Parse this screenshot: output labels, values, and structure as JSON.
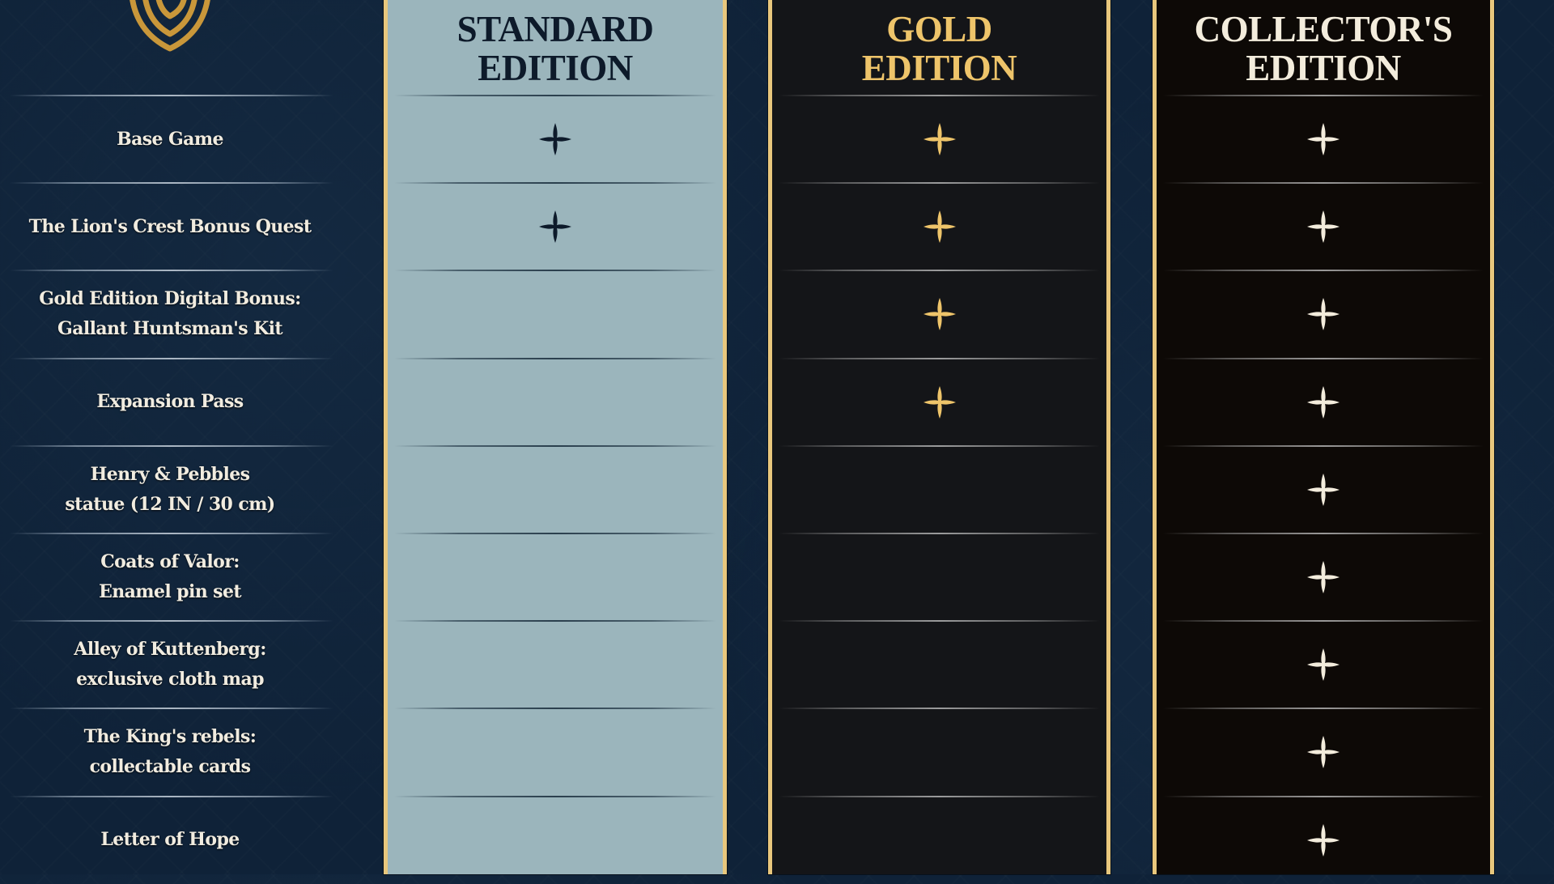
{
  "logo": {
    "icon": "shield-crest-icon",
    "color": "#c9973a"
  },
  "features": [
    {
      "label": "Base Game",
      "standard": true,
      "gold": true,
      "collector": true
    },
    {
      "label": "The Lion's Crest Bonus Quest",
      "standard": true,
      "gold": true,
      "collector": true
    },
    {
      "label": "Gold Edition Digital Bonus:\nGallant Huntsman's Kit",
      "standard": false,
      "gold": true,
      "collector": true
    },
    {
      "label": "Expansion Pass",
      "standard": false,
      "gold": true,
      "collector": true
    },
    {
      "label": "Henry & Pebbles\nstatue (12 IN / 30 cm)",
      "standard": false,
      "gold": false,
      "collector": true
    },
    {
      "label": "Coats of Valor:\nEnamel pin set",
      "standard": false,
      "gold": false,
      "collector": true
    },
    {
      "label": "Alley of Kuttenberg:\nexclusive cloth map",
      "standard": false,
      "gold": false,
      "collector": true
    },
    {
      "label": "The King's rebels:\ncollectable cards",
      "standard": false,
      "gold": false,
      "collector": true
    },
    {
      "label": "Letter of Hope",
      "standard": false,
      "gold": false,
      "collector": true
    }
  ],
  "editions": {
    "standard": {
      "title": "STANDARD\nEDITION",
      "star_color": "#0d1a2a",
      "icon": "four-point-star-icon"
    },
    "gold": {
      "title": "GOLD\nEDITION",
      "star_color": "#eec46a",
      "icon": "four-point-star-icon"
    },
    "collector": {
      "title": "COLLECTOR'S\nEDITION",
      "star_color": "#f3ecdc",
      "icon": "four-point-star-icon"
    }
  },
  "colors": {
    "background": "#0f2238",
    "border_gold": "#e8c77d",
    "standard_bg": "#9bb5bc",
    "gold_bg": "#141518",
    "collector_bg": "#0d0906"
  }
}
